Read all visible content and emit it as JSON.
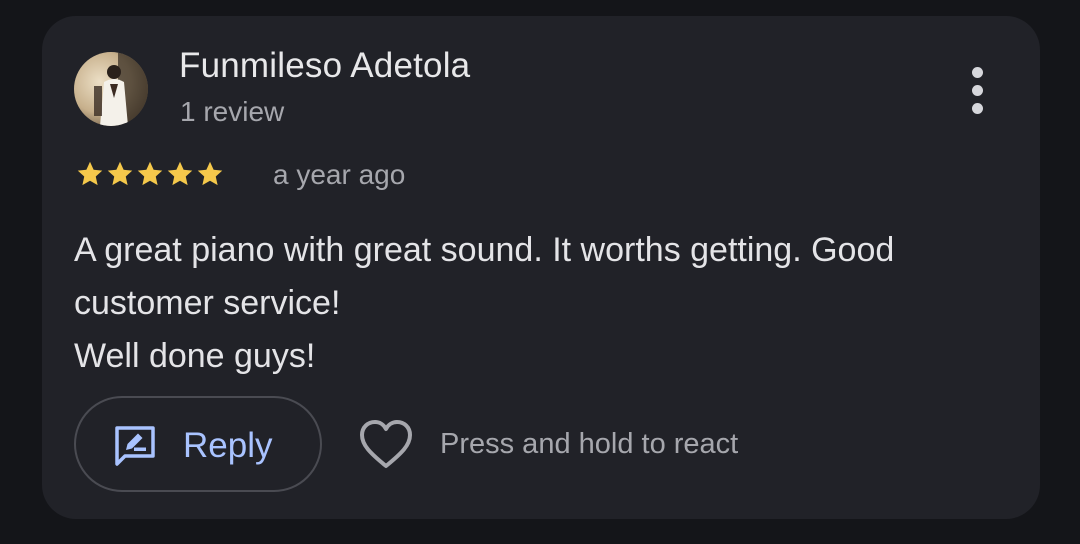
{
  "review": {
    "author_name": "Funmileso Adetola",
    "review_count": "1 review",
    "rating": 5,
    "rating_max": 5,
    "time": "a year ago",
    "text_lines": [
      "A great piano with great sound. It worths getting. Good",
      "customer service!",
      "Well done guys!"
    ]
  },
  "actions": {
    "reply_label": "Reply",
    "react_hint": "Press and hold to react"
  },
  "icons": {
    "more": "more-vert-icon",
    "star": "star-icon",
    "reply": "rate-review-icon",
    "heart": "heart-outline-icon"
  },
  "colors": {
    "background": "#141519",
    "card": "#212228",
    "star": "#f5c84b",
    "accent": "#a9c3ff"
  }
}
